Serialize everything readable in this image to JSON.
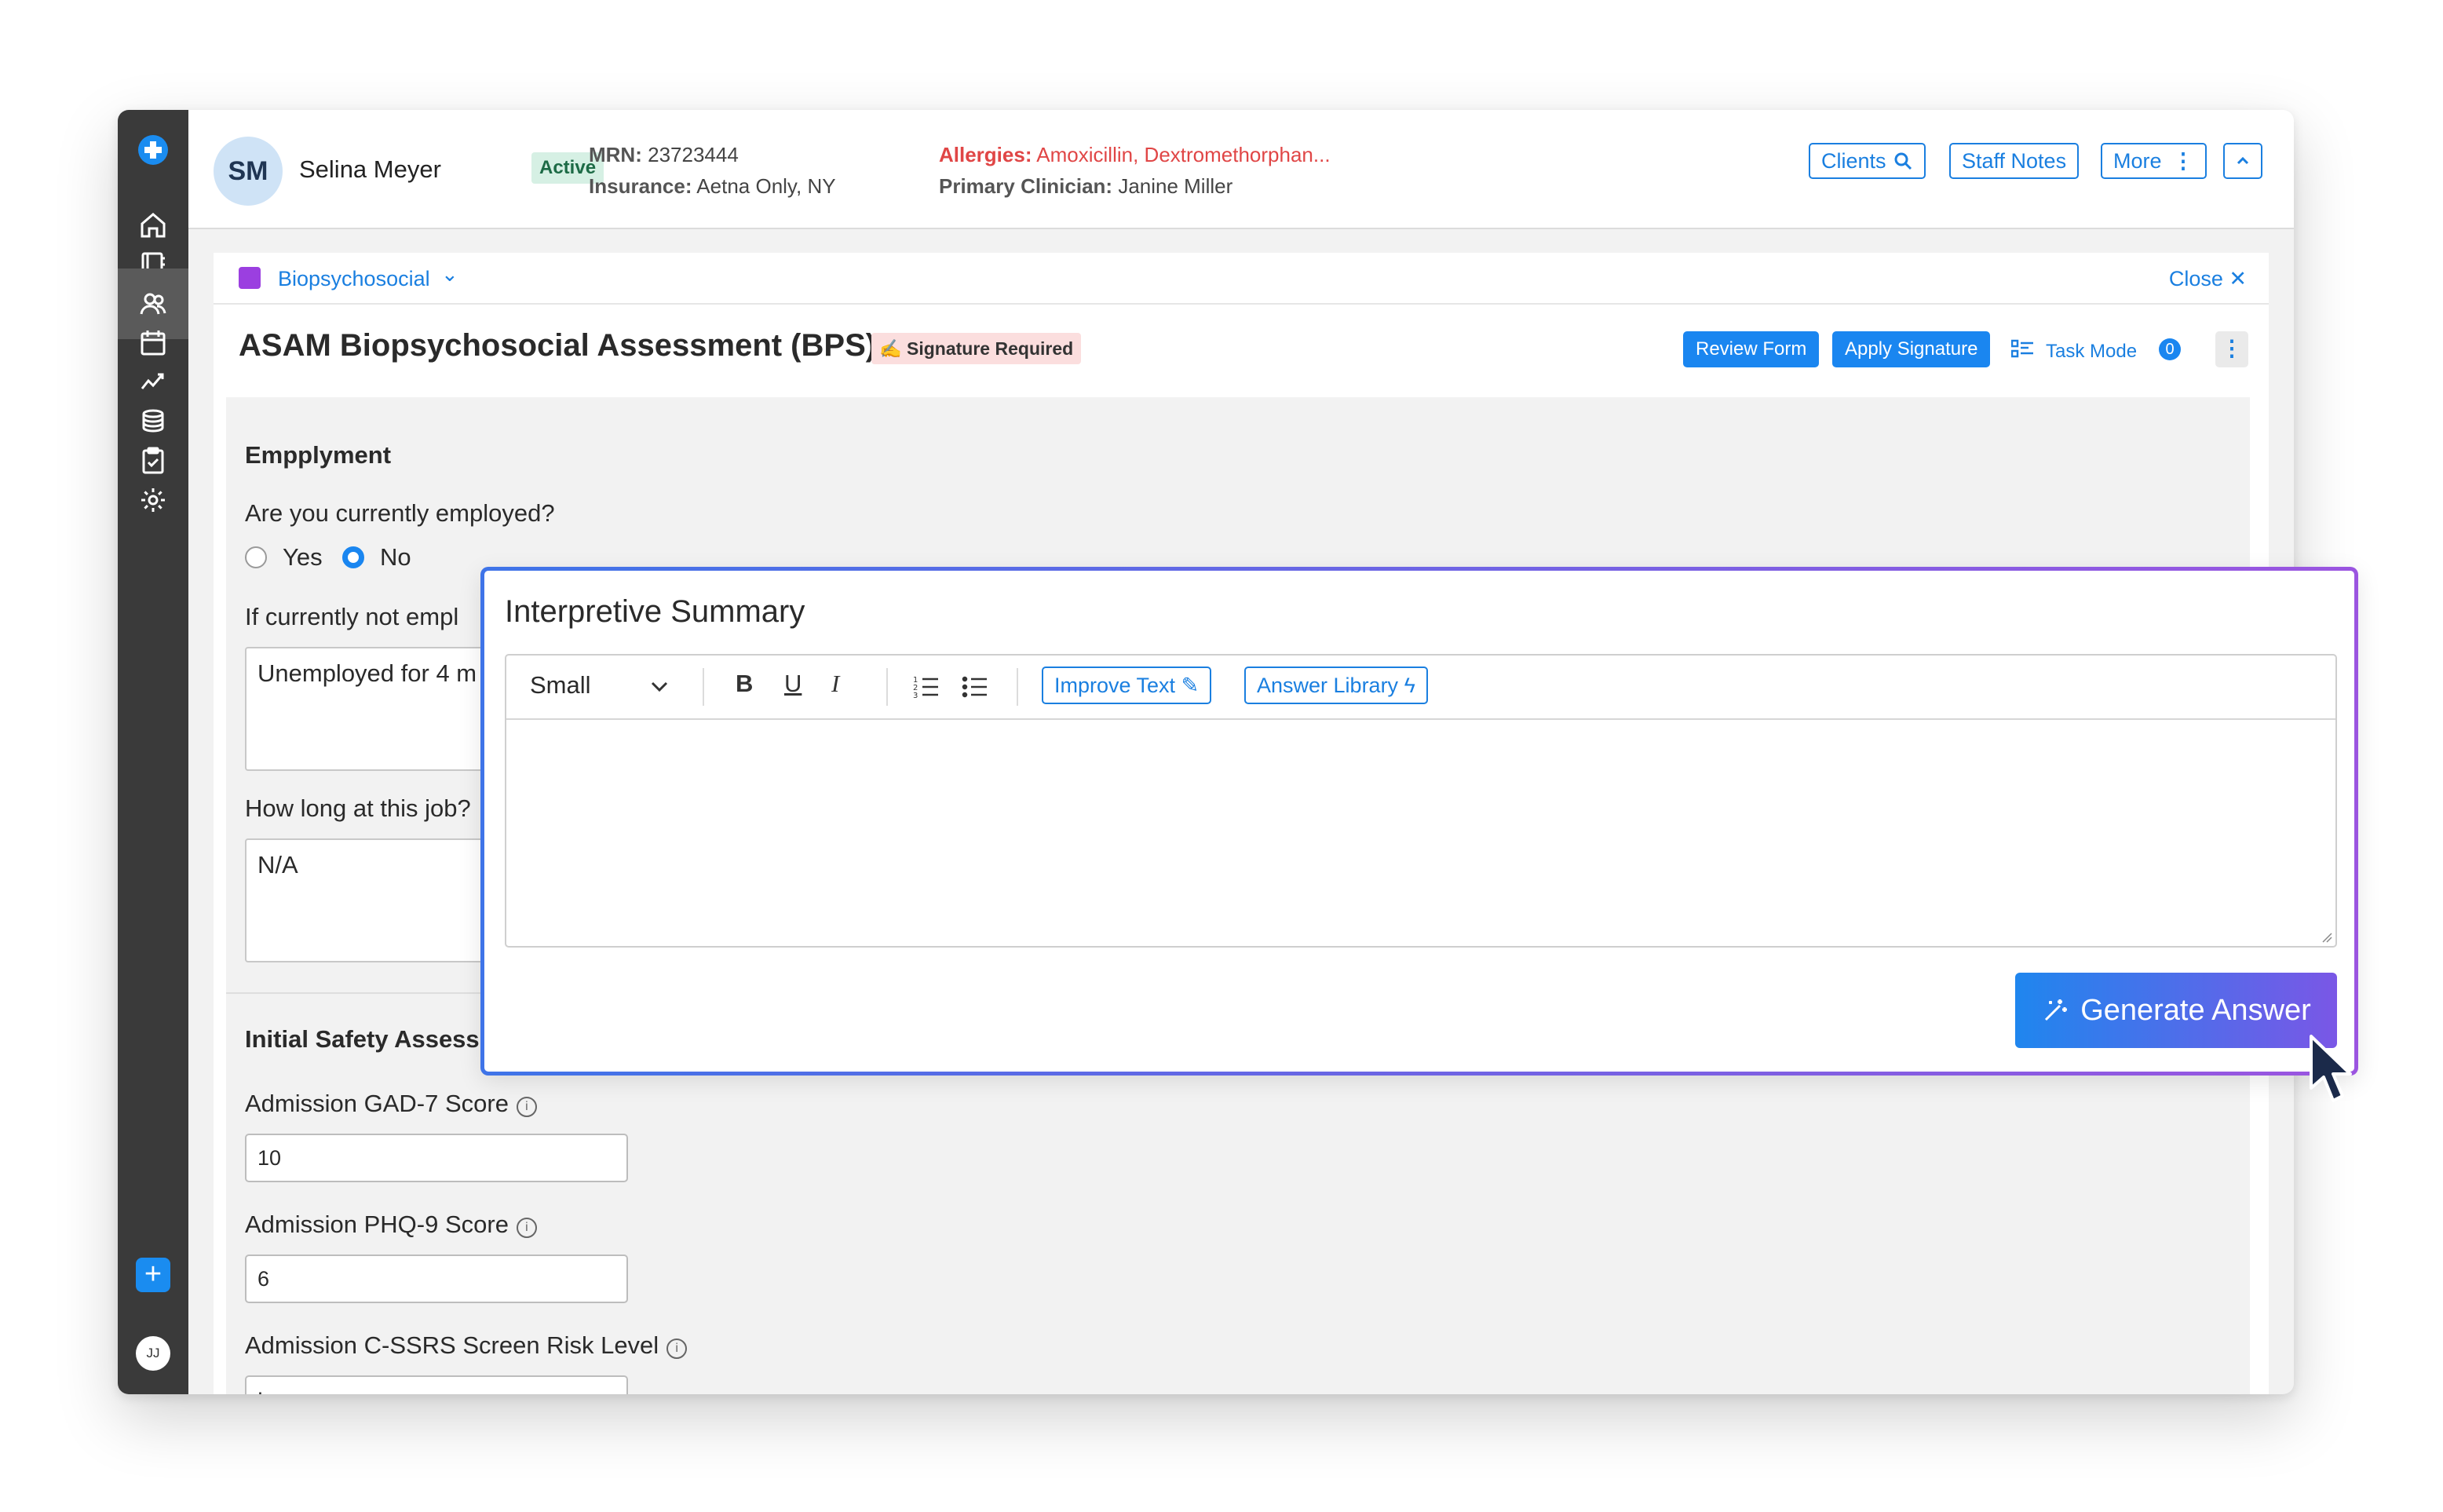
{
  "patient": {
    "initials": "SM",
    "name": "Selina Meyer",
    "status": "Active",
    "mrn_label": "MRN:",
    "mrn": "23723444",
    "insurance_label": "Insurance:",
    "insurance": "Aetna Only, NY",
    "allergies_label": "Allergies:",
    "allergies": "Amoxicillin, Dextromethorphan...",
    "clinician_label": "Primary Clinician:",
    "clinician": "Janine Miller"
  },
  "header_buttons": {
    "clients": "Clients",
    "staff_notes": "Staff Notes",
    "more": "More"
  },
  "user": {
    "initials": "JJ"
  },
  "breadcrumb": {
    "label": "Biopsychosocial",
    "close": "Close"
  },
  "form": {
    "title": "ASAM Biopsychosocial Assessment (BPS)",
    "signature_badge": "Signature Required",
    "review_button": "Review Form",
    "apply_signature_button": "Apply Signature",
    "task_mode": "Task Mode",
    "task_count": "0"
  },
  "employment": {
    "section_title": "Empplyment",
    "q_employed": "Are you currently employed?",
    "opt_yes": "Yes",
    "opt_no": "No",
    "selected": "No",
    "q_not_employed": "If currently not empl",
    "a_not_employed": "Unemployed for 4 m",
    "q_how_long": "How long at this job?",
    "a_how_long": "N/A"
  },
  "safety": {
    "section_title": "Initial Safety Assess",
    "gad7_label": "Admission GAD-7 Score",
    "gad7_value": "10",
    "phq9_label": "Admission PHQ-9 Score",
    "phq9_value": "6",
    "cssrs_label": "Admission C-SSRS Screen Risk Level",
    "cssrs_value": "Low"
  },
  "summary_modal": {
    "title": "Interpretive Summary",
    "font_size": "Small",
    "improve_text": "Improve Text",
    "answer_library": "Answer Library",
    "editor_content": "",
    "generate_button": "Generate Answer"
  },
  "colors": {
    "accent": "#1a7fe0",
    "sidebar": "#3a3a3a",
    "allergy_red": "#e04646",
    "active_badge_bg": "#d6f0e4",
    "signature_badge_bg": "#fbdede",
    "folder_purple": "#9b3fe0"
  }
}
